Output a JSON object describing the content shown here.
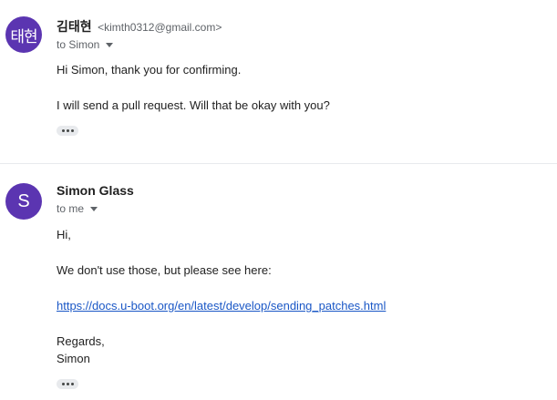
{
  "messages": [
    {
      "avatar_text": "태현",
      "avatar_color": "#5b35b1",
      "sender_name": "김태현",
      "sender_email": "<kimth0312@gmail.com>",
      "recipient": "to Simon",
      "lines": [
        "Hi Simon, thank you for confirming.",
        "I will send a pull request. Will that be okay with you?"
      ]
    },
    {
      "avatar_text": "S",
      "avatar_color": "#5b35b1",
      "sender_name": "Simon Glass",
      "recipient": "to me",
      "lines": [
        "Hi,",
        "We don't use those, but please see here:",
        "Regards,",
        "Simon"
      ],
      "link": "https://docs.u-boot.org/en/latest/develop/sending_patches.html"
    }
  ],
  "colors": {
    "avatar": "#5b35b1",
    "link": "#1a57c6",
    "secondary_text": "#5f6368"
  },
  "icons": {
    "recipient_details": "chevron-down-icon",
    "show_trimmed": "more-horizontal-icon"
  }
}
